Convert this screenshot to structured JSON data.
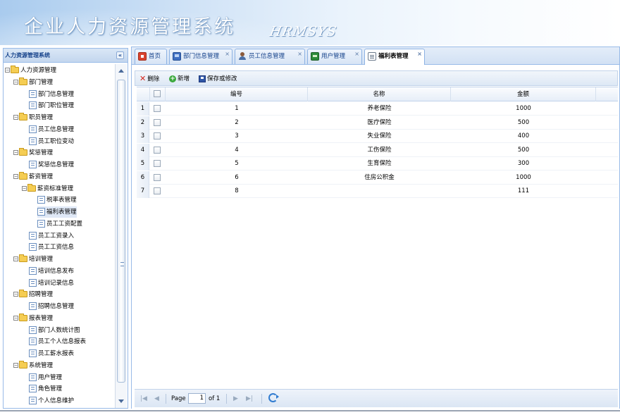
{
  "header": {
    "title": "企业人力资源管理系统",
    "subtitle": "HRMSYS"
  },
  "sidebar": {
    "title": "人力资源管理系统",
    "collapse_glyph": "«",
    "tree": [
      {
        "label": "人力资源管理",
        "type": "folder",
        "level": 0
      },
      {
        "label": "部门管理",
        "type": "folder",
        "level": 1
      },
      {
        "label": "部门信息管理",
        "type": "leaf",
        "level": 2
      },
      {
        "label": "部门职位管理",
        "type": "leaf",
        "level": 2
      },
      {
        "label": "职员管理",
        "type": "folder",
        "level": 1
      },
      {
        "label": "员工信息管理",
        "type": "leaf",
        "level": 2
      },
      {
        "label": "员工职位变动",
        "type": "leaf",
        "level": 2
      },
      {
        "label": "奖惩管理",
        "type": "folder",
        "level": 1
      },
      {
        "label": "奖惩信息管理",
        "type": "leaf",
        "level": 2
      },
      {
        "label": "薪资管理",
        "type": "folder",
        "level": 1
      },
      {
        "label": "薪资标准管理",
        "type": "folder",
        "level": 2
      },
      {
        "label": "税率表管理",
        "type": "leaf",
        "level": 3
      },
      {
        "label": "福利表管理",
        "type": "leaf",
        "level": 3,
        "selected": true
      },
      {
        "label": "员工工资配置",
        "type": "leaf",
        "level": 3
      },
      {
        "label": "员工工资录入",
        "type": "leaf",
        "level": 2
      },
      {
        "label": "员工工资信息",
        "type": "leaf",
        "level": 2
      },
      {
        "label": "培训管理",
        "type": "folder",
        "level": 1
      },
      {
        "label": "培训信息发布",
        "type": "leaf",
        "level": 2
      },
      {
        "label": "培训记录信息",
        "type": "leaf",
        "level": 2
      },
      {
        "label": "招聘管理",
        "type": "folder",
        "level": 1
      },
      {
        "label": "招聘信息管理",
        "type": "leaf",
        "level": 2
      },
      {
        "label": "报表管理",
        "type": "folder",
        "level": 1
      },
      {
        "label": "部门人数统计图",
        "type": "leaf",
        "level": 2
      },
      {
        "label": "员工个人信息报表",
        "type": "leaf",
        "level": 2
      },
      {
        "label": "员工薪水报表",
        "type": "leaf",
        "level": 2
      },
      {
        "label": "系统管理",
        "type": "folder",
        "level": 1
      },
      {
        "label": "用户管理",
        "type": "leaf",
        "level": 2
      },
      {
        "label": "角色管理",
        "type": "leaf",
        "level": 2
      },
      {
        "label": "个人信息维护",
        "type": "leaf",
        "level": 2
      }
    ]
  },
  "tabs": [
    {
      "label": "首页",
      "icon": "home-icon",
      "closable": false,
      "active": false
    },
    {
      "label": "部门信息管理",
      "icon": "department-icon",
      "closable": true,
      "active": false
    },
    {
      "label": "员工信息管理",
      "icon": "employee-icon",
      "closable": true,
      "active": false
    },
    {
      "label": "用户管理",
      "icon": "user-icon",
      "closable": true,
      "active": false
    },
    {
      "label": "福利表管理",
      "icon": "document-icon",
      "closable": true,
      "active": true
    }
  ],
  "tab_close_glyph": "×",
  "toolbar": {
    "delete_label": "删除",
    "add_label": "新增",
    "save_label": "保存或修改"
  },
  "grid": {
    "columns": [
      "编号",
      "名称",
      "金额"
    ],
    "rows": [
      {
        "num": "1",
        "id": "1",
        "name": "养老保险",
        "amount": "1000"
      },
      {
        "num": "2",
        "id": "2",
        "name": "医疗保险",
        "amount": "500"
      },
      {
        "num": "3",
        "id": "3",
        "name": "失业保险",
        "amount": "400"
      },
      {
        "num": "4",
        "id": "4",
        "name": "工伤保险",
        "amount": "500"
      },
      {
        "num": "5",
        "id": "5",
        "name": "生育保险",
        "amount": "300"
      },
      {
        "num": "6",
        "id": "6",
        "name": "住房公积金",
        "amount": "1000"
      },
      {
        "num": "7",
        "id": "8",
        "name": "",
        "amount": "111"
      }
    ]
  },
  "pager": {
    "page_label": "Page",
    "page_value": "1",
    "of_label": "of 1",
    "first_glyph": "|◀",
    "prev_glyph": "◀",
    "next_glyph": "▶",
    "last_glyph": "▶|"
  }
}
